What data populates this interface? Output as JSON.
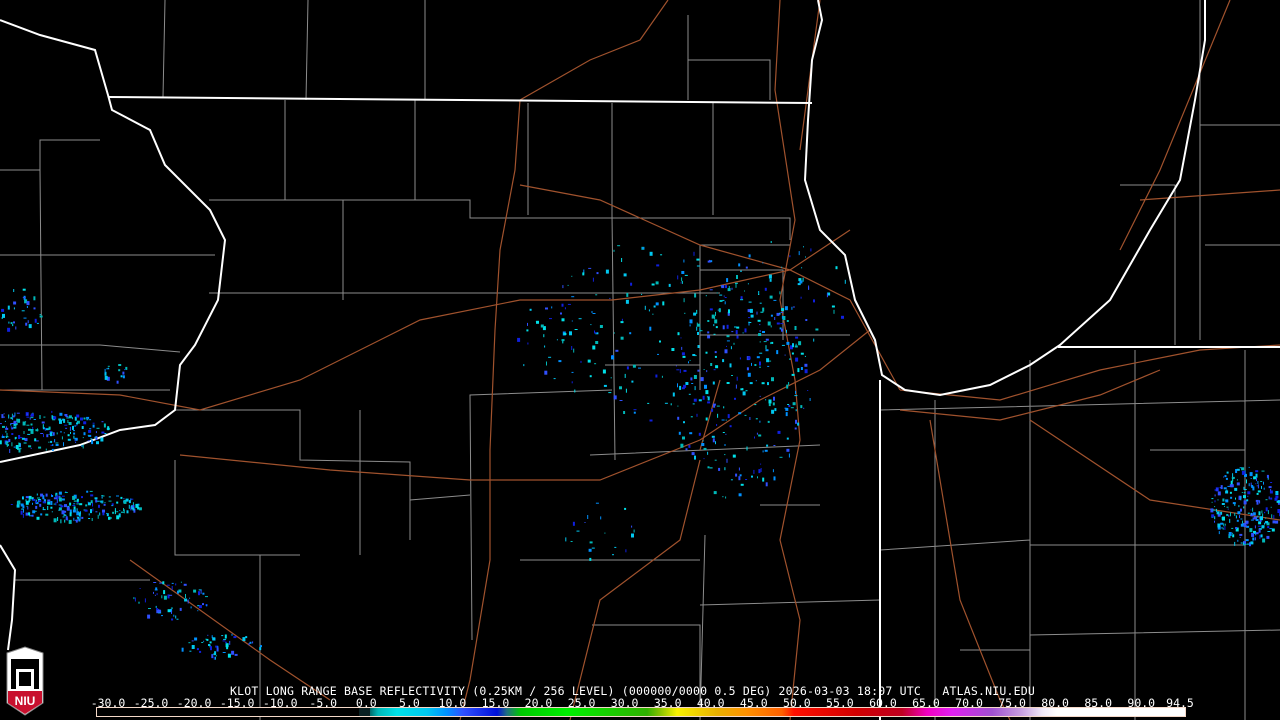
{
  "product_title": "KLOT LONG RANGE BASE REFLECTIVITY (0.25KM / 256 LEVEL) (000000/0000 0.5 DEG) 2026-03-03 18:07 UTC   ATLAS.NIU.EDU",
  "legend": {
    "ticks": [
      "-30.0",
      "-25.0",
      "-20.0",
      "-15.0",
      "-10.0",
      "-5.0",
      "0.0",
      "5.0",
      "10.0",
      "15.0",
      "20.0",
      "25.0",
      "30.0",
      "35.0",
      "40.0",
      "45.0",
      "50.0",
      "55.0",
      "60.0",
      "65.0",
      "70.0",
      "75.0",
      "80.0",
      "85.0",
      "90.0",
      "94.5"
    ],
    "units_range": [
      -30.0,
      94.5
    ]
  },
  "logo": {
    "text": "NIU"
  },
  "colors": {
    "state_border": "#ffffff",
    "county_line": "#8c8c8c",
    "highway": "#a0522d",
    "background": "#000000"
  }
}
